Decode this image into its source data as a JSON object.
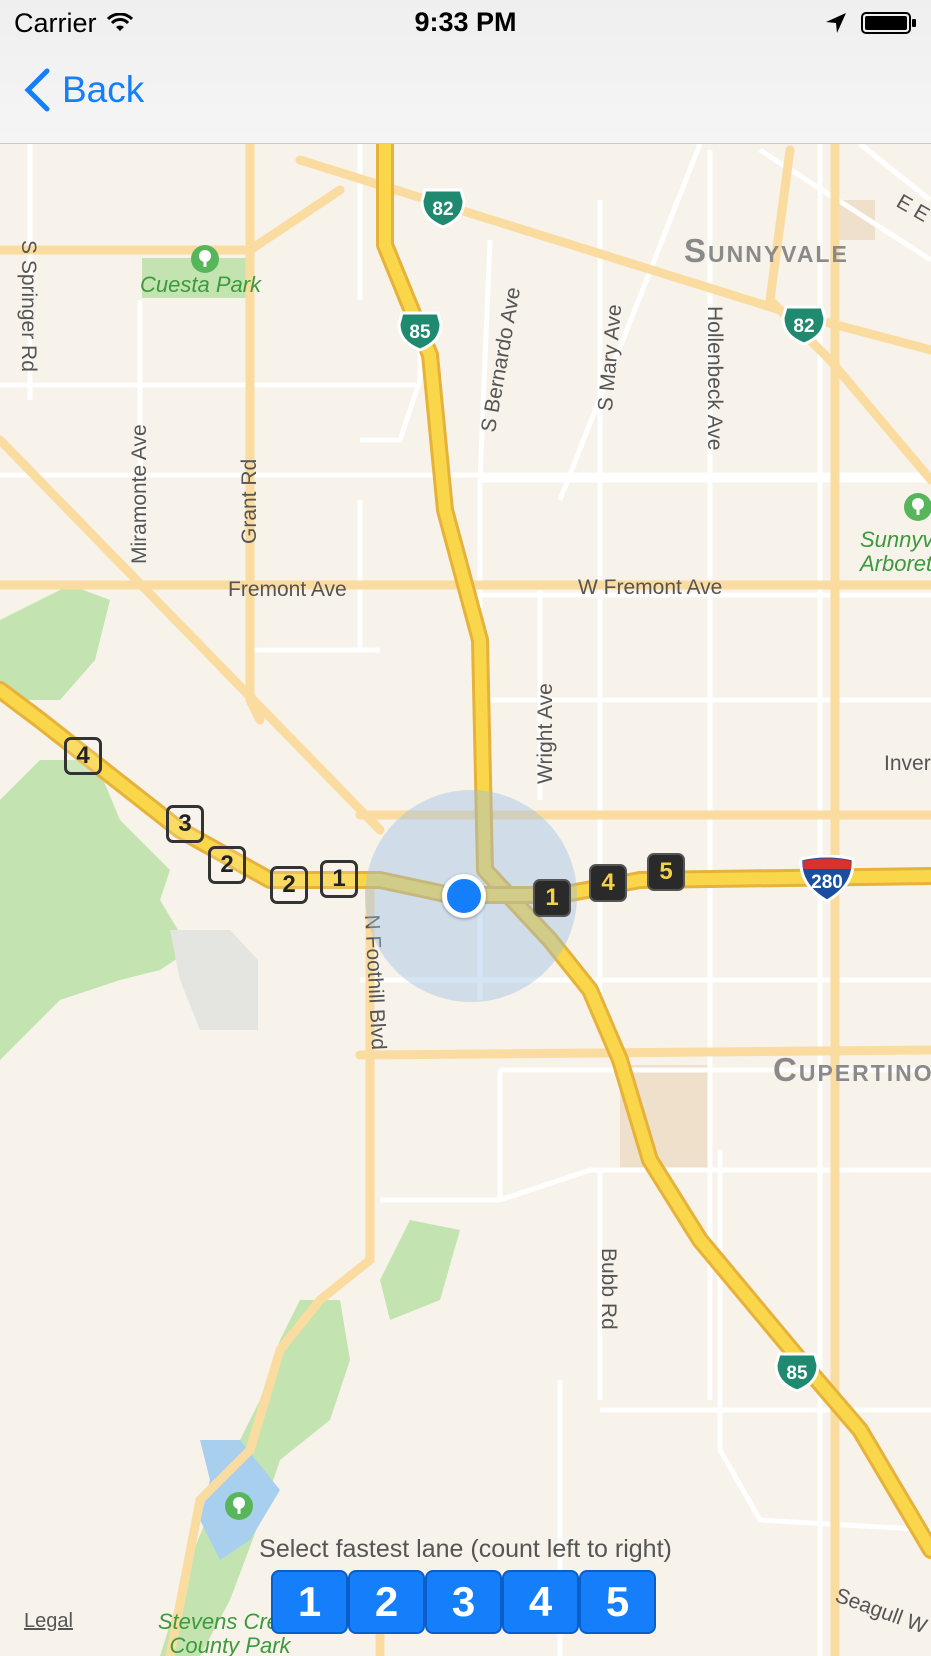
{
  "status": {
    "carrier": "Carrier",
    "time": "9:33 PM"
  },
  "nav": {
    "back_label": "Back"
  },
  "map": {
    "cities": [
      "Sunnyvale",
      "Cupertino"
    ],
    "parks": [
      "Cuesta Park",
      "Sunnyvale Arboretum",
      "Stevens Creek County Park"
    ],
    "streets": {
      "s_springer": "S Springer Rd",
      "miramonte": "Miramonte Ave",
      "grant": "Grant Rd",
      "fremont": "Fremont Ave",
      "w_fremont": "W Fremont Ave",
      "s_bernardo": "S Bernardo Ave",
      "s_mary": "S Mary Ave",
      "hollenbeck": "Hollenbeck Ave",
      "wright": "Wright Ave",
      "n_foothill": "N Foothill Blvd",
      "bubb": "Bubb Rd",
      "inverness": "Inver",
      "seagull": "Seagull W",
      "e_edge": "E E"
    },
    "shields": {
      "route82_a": "82",
      "route82_b": "82",
      "route85_a": "85",
      "route85_b": "85",
      "interstate280": "280"
    },
    "lane_markers_outline": [
      "4",
      "3",
      "2",
      "2",
      "1"
    ],
    "lane_markers_filled": [
      "1",
      "4",
      "5"
    ]
  },
  "footer": {
    "legal": "Legal",
    "prompt": "Select fastest lane (count left to right)",
    "lanes": [
      "1",
      "2",
      "3",
      "4",
      "5"
    ]
  },
  "colors": {
    "accent": "#147efb",
    "highway": "#f5c842",
    "park": "#c3e4b1",
    "water": "#a8cfee"
  }
}
